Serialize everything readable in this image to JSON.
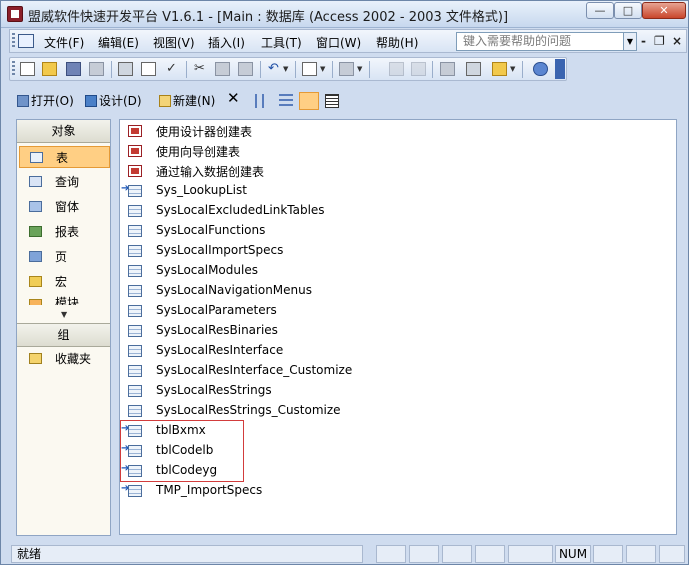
{
  "window": {
    "title": "盟威软件快速开发平台 V1.6.1 - [Main : 数据库 (Access 2002 - 2003 文件格式)]",
    "controls": {
      "minimize": "—",
      "maximize": "□",
      "close": "✕"
    }
  },
  "menubar": {
    "items": [
      "文件(F)",
      "编辑(E)",
      "视图(V)",
      "插入(I)",
      "工具(T)",
      "窗口(W)",
      "帮助(H)"
    ],
    "help_placeholder": "键入需要帮助的问题",
    "mdi_controls": {
      "minimize": "-",
      "restore": "❐",
      "close": "×"
    }
  },
  "toolbar": {
    "icons": [
      "new-icon",
      "open-icon",
      "save-icon",
      "file-search-icon",
      "print-icon",
      "print-preview-icon",
      "spelling-icon",
      "cut-icon",
      "copy-icon",
      "paste-icon",
      "undo-icon",
      "office-links-icon",
      "analyze-icon",
      "code-icon",
      "script-icon",
      "properties-icon",
      "relationships-icon",
      "new-object-icon",
      "help-icon"
    ]
  },
  "object_toolbar": {
    "open_label": "打开(O)",
    "design_label": "设计(D)",
    "new_label": "新建(N)",
    "delete_glyph": "✕",
    "view_glyphs": [
      "small-icons",
      "list",
      "details"
    ]
  },
  "sidebar": {
    "header": "对象",
    "items": [
      {
        "label": "表",
        "icon": "table-icon",
        "selected": true
      },
      {
        "label": "查询",
        "icon": "query-icon"
      },
      {
        "label": "窗体",
        "icon": "form-icon"
      },
      {
        "label": "报表",
        "icon": "report-icon"
      },
      {
        "label": "页",
        "icon": "page-icon"
      },
      {
        "label": "宏",
        "icon": "macro-icon"
      },
      {
        "label": "模块",
        "icon": "module-icon"
      }
    ],
    "group_header": "组",
    "favorites": "收藏夹"
  },
  "objects": [
    {
      "label": "使用设计器创建表",
      "kind": "wizard"
    },
    {
      "label": "使用向导创建表",
      "kind": "wizard"
    },
    {
      "label": "通过输入数据创建表",
      "kind": "wizard"
    },
    {
      "label": "Sys_LookupList",
      "kind": "linked",
      "selected": true
    },
    {
      "label": "SysLocalExcludedLinkTables",
      "kind": "table"
    },
    {
      "label": "SysLocalFunctions",
      "kind": "table"
    },
    {
      "label": "SysLocalImportSpecs",
      "kind": "table"
    },
    {
      "label": "SysLocalModules",
      "kind": "table"
    },
    {
      "label": "SysLocalNavigationMenus",
      "kind": "table"
    },
    {
      "label": "SysLocalParameters",
      "kind": "table"
    },
    {
      "label": "SysLocalResBinaries",
      "kind": "table"
    },
    {
      "label": "SysLocalResInterface",
      "kind": "table"
    },
    {
      "label": "SysLocalResInterface_Customize",
      "kind": "table"
    },
    {
      "label": "SysLocalResStrings",
      "kind": "table"
    },
    {
      "label": "SysLocalResStrings_Customize",
      "kind": "table"
    },
    {
      "label": "tblBxmx",
      "kind": "linked"
    },
    {
      "label": "tblCodelb",
      "kind": "linked"
    },
    {
      "label": "tblCodeyg",
      "kind": "linked"
    },
    {
      "label": "TMP_ImportSpecs",
      "kind": "linked"
    }
  ],
  "statusbar": {
    "text": "就绪",
    "num": "NUM"
  },
  "colors": {
    "selection": "#ffcf84",
    "highlight_box": "#d23c3c",
    "chrome": "#cfdcef"
  }
}
